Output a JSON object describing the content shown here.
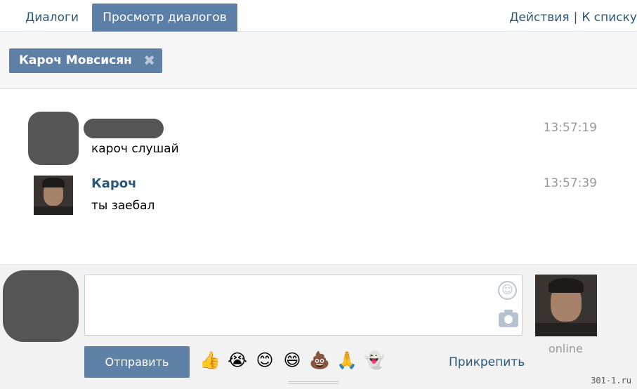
{
  "tabs": [
    {
      "label": "Диалоги"
    },
    {
      "label": "Просмотр диалогов"
    }
  ],
  "header_actions": {
    "actions_label": "Действия",
    "separator": "|",
    "to_list_label": "К списку"
  },
  "chip": {
    "label": "Кароч Мовсисян",
    "remove_icon": "close-icon",
    "remove_glyph": "✖"
  },
  "messages": [
    {
      "name": "",
      "text": "кароч слушай",
      "time": "13:57:19"
    },
    {
      "name": "Кароч",
      "text": "ты заебал",
      "time": "13:57:39"
    }
  ],
  "composer": {
    "input_value": "",
    "send_label": "Отправить",
    "attach_label": "Прикрепить",
    "status": "online",
    "smile_glyph": "☺"
  },
  "emojis": [
    "👍",
    "😭",
    "😊",
    "😄",
    "💩",
    "🙏",
    "👻"
  ],
  "watermark": "301-1.ru",
  "colors": {
    "accent": "#5f80a6",
    "link": "#2b587a",
    "time": "#999999"
  }
}
